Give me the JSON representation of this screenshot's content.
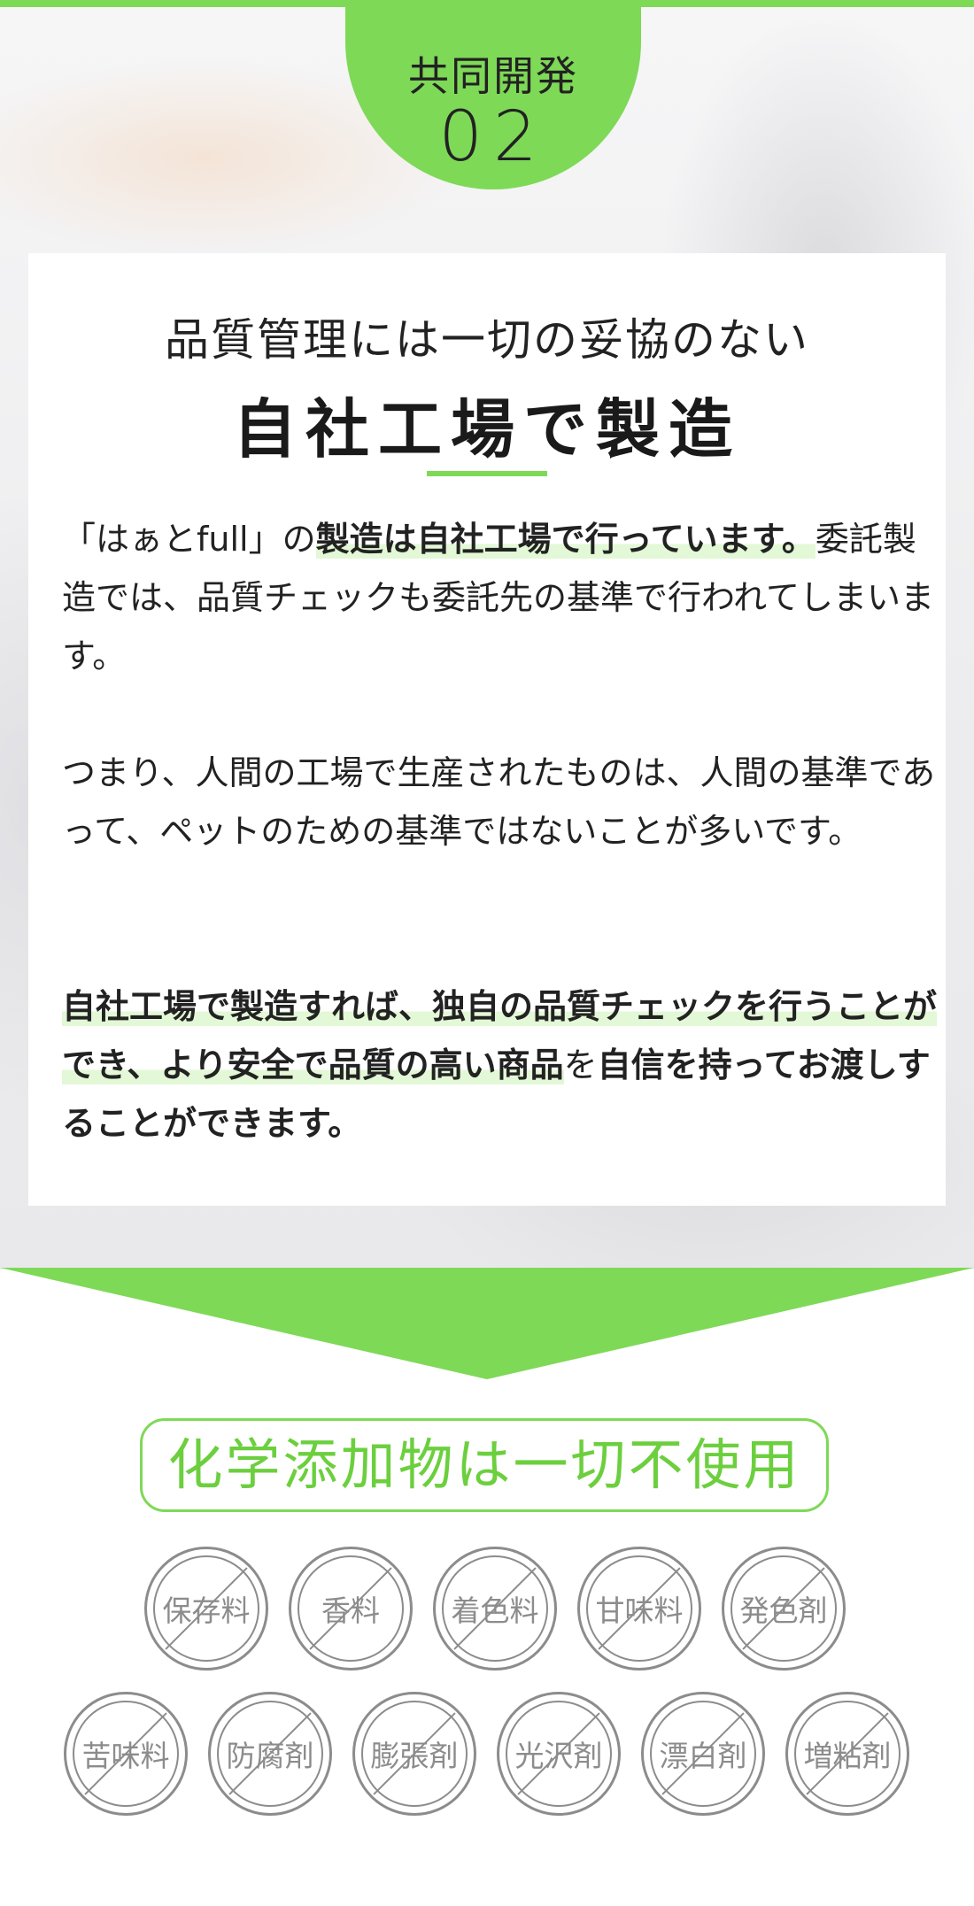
{
  "badge": {
    "title": "共同開発",
    "number": "02"
  },
  "card": {
    "heading_sub": "品質管理には一切の妥協のない",
    "heading_main": "自社工場で製造",
    "p1": {
      "lead": "「はぁとfull」の",
      "highlight": "製造は自社工場で行っています。",
      "rest": "委託製造では、品質チェックも委託先の基準で行われてしまいます。"
    },
    "p2": "つまり、人間の工場で生産されたものは、人間の基準であって、ペットのための基準ではないことが多いです。",
    "p3": {
      "highlight": "自社工場で製造すれば、独自の品質チェックを行うことができ、より安全で品質の高い商品",
      "mid": "を",
      "tail": "自信を持ってお渡しすることができます。"
    }
  },
  "additive_free": {
    "title": "化学添加物は一切不使用",
    "row1": [
      "保存料",
      "香料",
      "着色料",
      "甘味料",
      "発色剤"
    ],
    "row2": [
      "苦味料",
      "防腐剤",
      "膨張剤",
      "光沢剤",
      "漂白剤",
      "増粘剤"
    ]
  },
  "colors": {
    "accent": "#7ed957",
    "icon_gray": "#8c8c8c"
  }
}
